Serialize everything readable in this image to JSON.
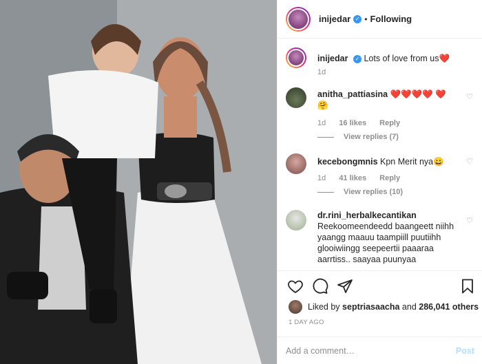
{
  "post": {
    "username": "inijedar",
    "follow_status": "Following",
    "separator": "•",
    "verified_glyph": "✓"
  },
  "caption": {
    "username": "inijedar",
    "text": "Lots of love from us❤️",
    "time": "1d"
  },
  "comments": [
    {
      "username": "anitha_pattiasina",
      "text": "❤️❤️❤️❤️ ❤️🤗",
      "time": "1d",
      "likes": "16 likes",
      "reply": "Reply",
      "view_replies": "View replies (7)"
    },
    {
      "username": "kecebongmnis",
      "text": "Kpn Merit nya😀",
      "time": "1d",
      "likes": "41 likes",
      "reply": "Reply",
      "view_replies": "View replies (10)"
    },
    {
      "username": "dr.rini_herbalkecantikan",
      "text": "Reekoomeendeedd baangeett niihh yaangg maauu taampiill puutiihh glooiwiingg seepeertii paaaraa aarrtiss.. saayaa puunyaa"
    }
  ],
  "likes_line": {
    "prefix": "Liked by",
    "user": "septriasaacha",
    "middle": "and",
    "count": "286,041 others"
  },
  "timestamp": "1 DAY AGO",
  "add_comment": {
    "placeholder": "Add a comment…",
    "post_label": "Post"
  },
  "icons": {
    "like": "heart-icon",
    "comment": "comment-icon",
    "share": "share-icon",
    "save": "bookmark-icon",
    "comment_like": "small-heart-icon",
    "verified": "verified-badge-icon"
  },
  "colors": {
    "verified": "#3897f0",
    "post_button": "#b2dffc",
    "muted": "#8e8e8e",
    "heart": "#ed4956"
  }
}
